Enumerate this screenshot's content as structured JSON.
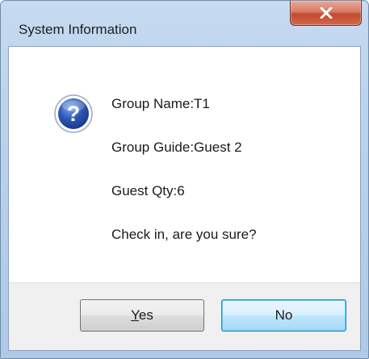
{
  "window": {
    "title": "System Information"
  },
  "message": {
    "icon": "question-icon",
    "lines": [
      "Group Name:T1",
      "Group Guide:Guest 2",
      "Guest Qty:6",
      "Check in, are you sure?"
    ]
  },
  "buttons": {
    "yes_label": "Yes",
    "no_label": "No"
  },
  "colors": {
    "titlebar": "#c6daf1",
    "close_button": "#c34a2d",
    "default_button_border": "#3c7fb1",
    "icon_blue": "#2d57b3"
  }
}
